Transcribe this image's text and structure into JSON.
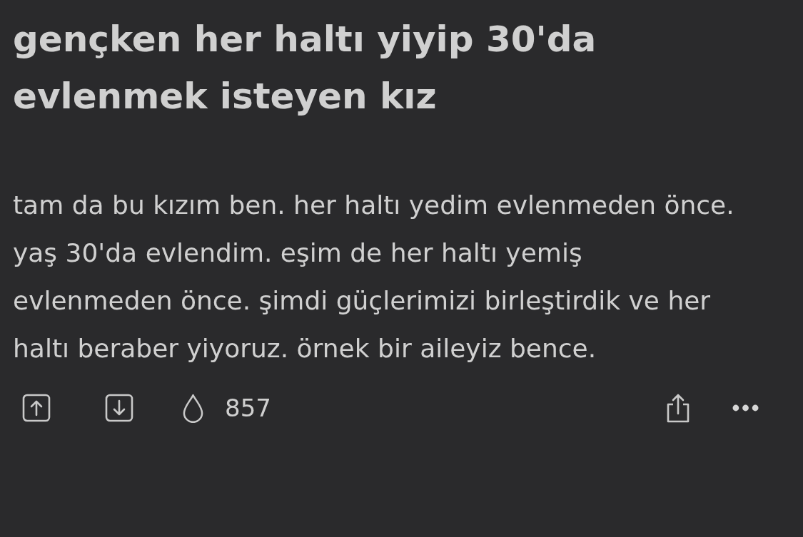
{
  "entry": {
    "title": "gençken her haltı yiyip 30'da evlenmek isteyen kız",
    "body_lines": [
      "tam da bu kızım ben. her haltı yedim evlenmeden önce.",
      "yaş 30'da evlendim. eşim de her haltı yemiş",
      "evlenmeden önce. şimdi güçlerimizi birleştirdik ve her",
      "haltı beraber yiyoruz. örnek bir aileyiz bence."
    ],
    "favorite_count": "857"
  }
}
